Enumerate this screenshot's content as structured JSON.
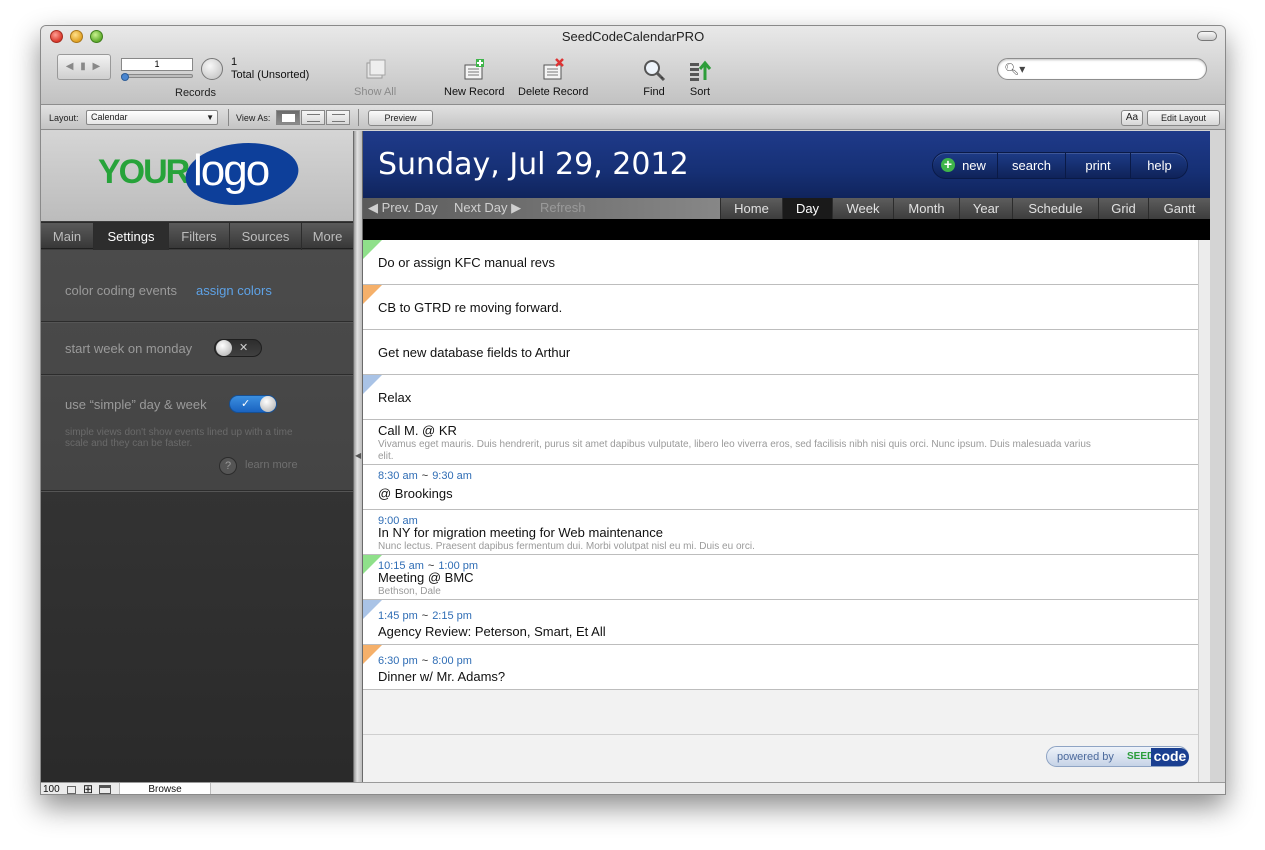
{
  "window": {
    "title": "SeedCodeCalendarPRO"
  },
  "toolbar": {
    "record_number": "1",
    "found_count": "1",
    "found_status": "Total (Unsorted)",
    "records_label": "Records",
    "show_all": "Show All",
    "new_record": "New Record",
    "delete_record": "Delete Record",
    "find": "Find",
    "sort": "Sort",
    "search_placeholder": ""
  },
  "layoutbar": {
    "layout_label": "Layout:",
    "layout_value": "Calendar",
    "view_as_label": "View As:",
    "preview": "Preview",
    "font_button": "Aa",
    "edit_layout": "Edit Layout"
  },
  "left": {
    "logo_your": "YOUR",
    "logo_logo": "logo",
    "tabs": [
      "Main",
      "Settings",
      "Filters",
      "Sources",
      "More"
    ],
    "active_tab": "Settings",
    "settings": {
      "color_coding_label": "color coding events",
      "assign_colors": "assign colors",
      "start_week_label": "start week on monday",
      "start_week_on": false,
      "simple_label": "use “simple” day & week",
      "simple_on": true,
      "simple_help": "simple views don't show events lined up with a time scale and they can be faster.",
      "learn_more_q": "?",
      "learn_more": "learn more"
    }
  },
  "calendar": {
    "date_heading": "Sunday, Jul 29, 2012",
    "actions": {
      "new": "new",
      "search": "search",
      "print": "print",
      "help": "help"
    },
    "nav": {
      "prev": "Prev. Day",
      "next": "Next Day",
      "refresh": "Refresh"
    },
    "views": [
      "Home",
      "Day",
      "Week",
      "Month",
      "Year",
      "Schedule",
      "Grid",
      "Gantt"
    ],
    "active_view": "Day",
    "events": [
      {
        "title": "Do or assign KFC manual revs",
        "color": "#8fe08a"
      },
      {
        "title": "CB to GTRD re moving forward.",
        "color": "#f5b06a"
      },
      {
        "title": "Get new database fields to Arthur",
        "color": ""
      },
      {
        "title": "Relax",
        "color": "#a9c3e6"
      },
      {
        "title": "Call M. @ KR",
        "desc": "Vivamus eget mauris. Duis hendrerit, purus sit amet dapibus vulputate, libero leo viverra eros, sed facilisis nibh nisi quis orci. Nunc ipsum. Duis malesuada varius",
        "desc2": "elit.",
        "color": ""
      },
      {
        "title": "@ Brookings",
        "start": "8:30 am",
        "end": "9:30 am",
        "color": ""
      },
      {
        "title": "In NY for migration meeting for Web maintenance",
        "start": "9:00 am",
        "desc": "Nunc lectus. Praesent dapibus fermentum dui. Morbi volutpat nisl eu mi. Duis eu orci.",
        "color": ""
      },
      {
        "title": "Meeting @ BMC",
        "start": "10:15 am",
        "end": "1:00 pm",
        "desc": "Bethson, Dale",
        "color": "#8fe08a"
      },
      {
        "title": "Agency Review: Peterson, Smart, Et All",
        "start": "1:45 pm",
        "end": "2:15 pm",
        "color": "#a9c3e6"
      },
      {
        "title": "Dinner w/ Mr. Adams?",
        "start": "6:30 pm",
        "end": "8:00 pm",
        "color": "#f5b06a"
      }
    ],
    "tilde": "~",
    "powered_by": "powered by",
    "powered_seed": "SEED",
    "powered_code": "code"
  },
  "status": {
    "zoom": "100",
    "mode": "Browse"
  }
}
